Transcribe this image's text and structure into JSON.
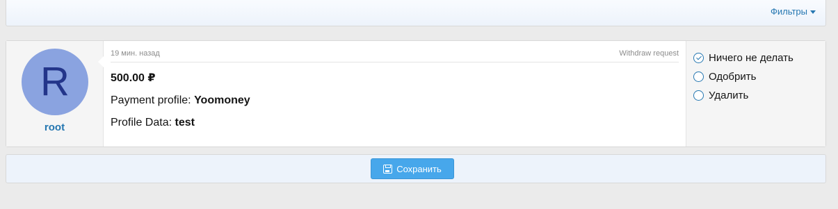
{
  "filter_bar": {
    "filters_label": "Фильтры",
    "filters_icon": "caret-down-icon"
  },
  "request": {
    "user": {
      "avatar_letter": "R",
      "avatar_color": "#8aa3e0",
      "name": "root"
    },
    "time_ago": "19 мин. назад",
    "type_label": "Withdraw request",
    "amount": "500.00 ₽",
    "payment_profile_label": "Payment profile:",
    "payment_profile_value": "Yoomoney",
    "profile_data_label": "Profile Data:",
    "profile_data_value": "test"
  },
  "actions": {
    "selected": "Ничего не делать",
    "options": [
      {
        "label": "Ничего не делать",
        "checked": true
      },
      {
        "label": "Одобрить",
        "checked": false
      },
      {
        "label": "Удалить",
        "checked": false
      }
    ]
  },
  "footer": {
    "save_label": "Сохранить",
    "save_icon": "save-icon"
  },
  "colors": {
    "accent": "#2577b1",
    "button": "#47a7eb"
  }
}
